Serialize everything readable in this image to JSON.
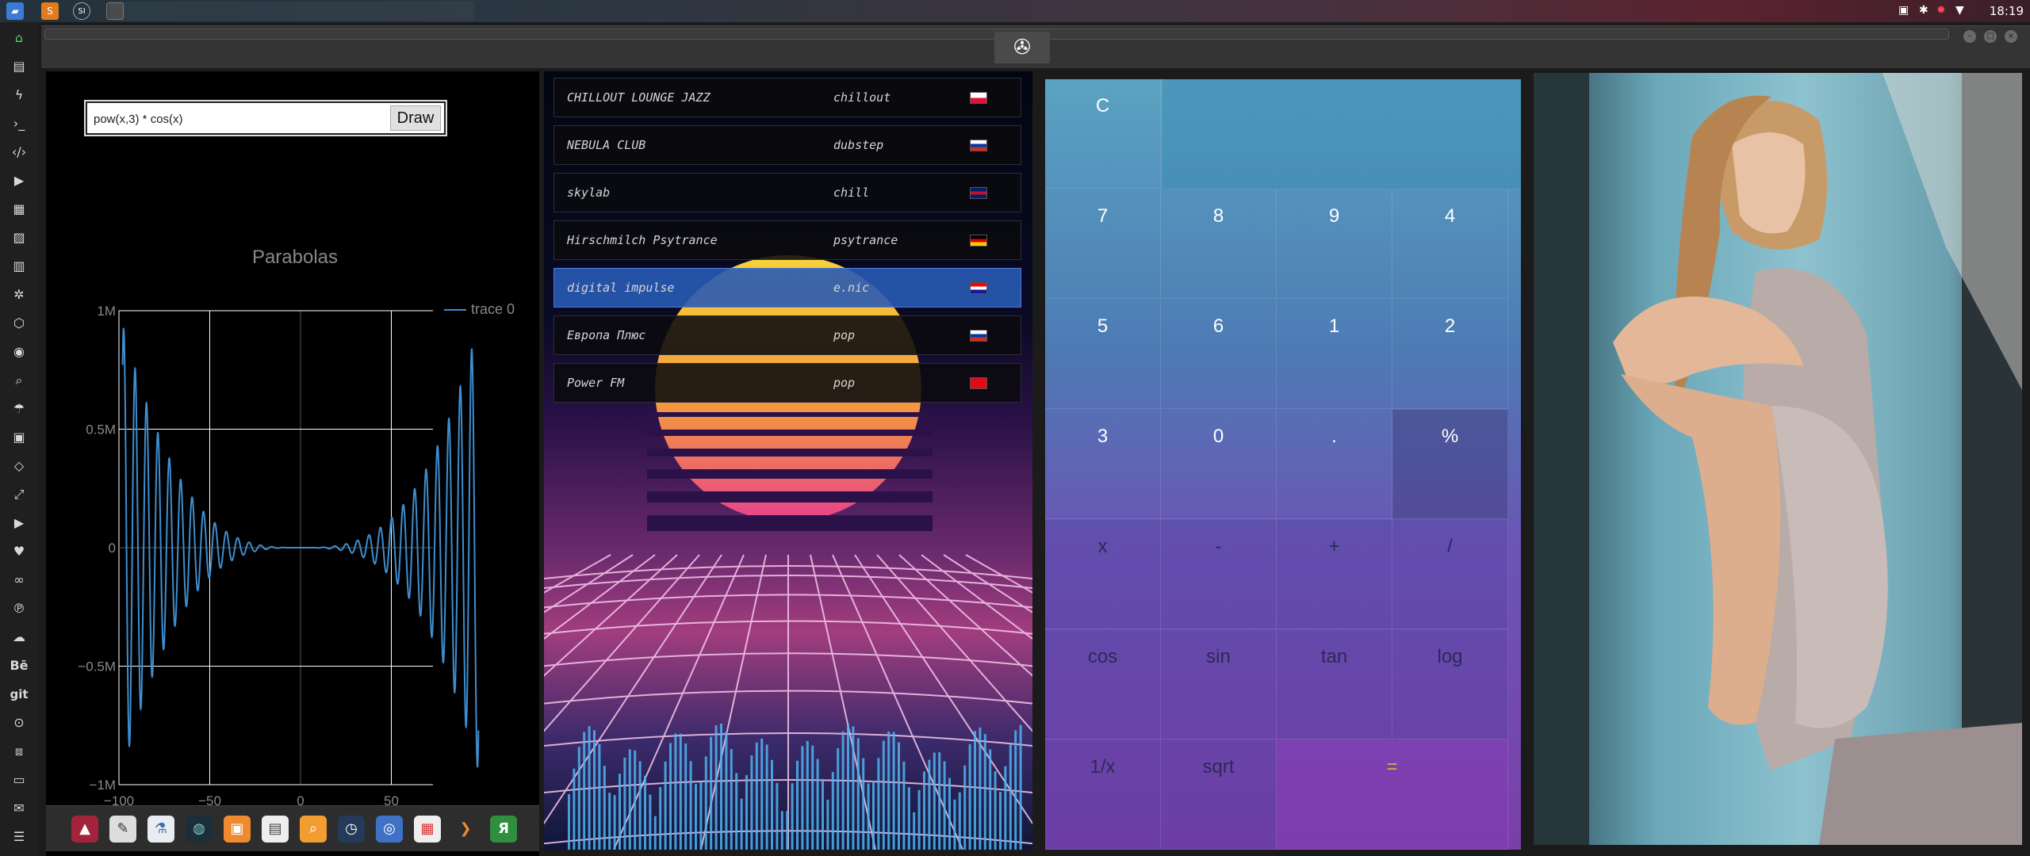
{
  "topbar": {
    "apps": [
      {
        "icon": "files-icon",
        "color": "#4a90e2"
      },
      {
        "icon": "sublime-icon",
        "color": "#f28c28"
      },
      {
        "icon": "rebel-icon",
        "label": "SI"
      },
      {
        "icon": "window-icon"
      }
    ],
    "clock": "18:19"
  },
  "dock": {
    "items": [
      "home-icon",
      "document-icon",
      "bolt-icon",
      "terminal-icon",
      "code-icon",
      "play-icon",
      "files-icon",
      "image-icon",
      "news-icon",
      "settings-icon",
      "network-icon",
      "globe-icon",
      "search-icon",
      "umbrella-icon",
      "contacts-icon",
      "tag-icon",
      "expand-icon",
      "youtube-icon",
      "heart-icon",
      "infinity-icon",
      "pinterest-icon",
      "cloud-icon",
      "behance-icon",
      "git-icon",
      "github-icon",
      "cubes-icon",
      "map-icon",
      "mail-icon",
      "list-icon"
    ],
    "behance_label": "Bē",
    "git_label": "git"
  },
  "plot": {
    "expression": "pow(x,3) * cos(x)",
    "draw_label": "Draw",
    "colors": {
      "trace": "#3e8ed0",
      "grid": "#ffffff",
      "text": "#888888"
    }
  },
  "chart_data": {
    "type": "line",
    "title": "Parabolas",
    "xlabel": "",
    "ylabel": "",
    "xlim": [
      -100,
      100
    ],
    "ylim": [
      -1000000,
      1000000
    ],
    "x_ticks": [
      "−100",
      "−50",
      "0",
      "50"
    ],
    "y_ticks": [
      "1M",
      "0.5M",
      "0",
      "−0.5M",
      "−1M"
    ],
    "legend": "top-right",
    "grid": true,
    "series": [
      {
        "name": "trace 0",
        "function": "pow(x,3) * cos(x)"
      }
    ]
  },
  "radio": {
    "stations": [
      {
        "name": "CHILLOUT LOUNGE JAZZ",
        "genre": "chillout",
        "flag": "flag-poland-icon",
        "active": false
      },
      {
        "name": "NEBULA CLUB",
        "genre": "dubstep",
        "flag": "flag-russia-icon",
        "active": false
      },
      {
        "name": "skylab",
        "genre": "chill",
        "flag": "flag-uk-icon",
        "active": false
      },
      {
        "name": "Hirschmilch Psytrance",
        "genre": "psytrance",
        "flag": "flag-germany-icon",
        "active": false
      },
      {
        "name": "digital impulse",
        "genre": "e.nic",
        "flag": "flag-croatia-icon",
        "active": true
      },
      {
        "name": "Европа Плюс",
        "genre": "pop",
        "flag": "flag-russia-icon",
        "active": false
      },
      {
        "name": "Power FM",
        "genre": "pop",
        "flag": "flag-turkey-icon",
        "active": false
      }
    ]
  },
  "calculator": {
    "clear": "C",
    "display": "",
    "keys": [
      "7",
      "8",
      "9",
      "4",
      "5",
      "6",
      "1",
      "2",
      "3",
      "0",
      ".",
      "%",
      "x",
      "-",
      "+",
      "/",
      "cos",
      "sin",
      "tan",
      "log",
      "1/x",
      "sqrt",
      "="
    ]
  },
  "bottom_dock": {
    "items": [
      "arch-icon",
      "editor-icon",
      "flask-icon",
      "planet-icon",
      "photos-icon",
      "browser-icon",
      "search-app-icon",
      "clock-app-icon",
      "globe-app-icon",
      "calendar-icon",
      "arrow-app-icon",
      "yandex-icon"
    ],
    "yandex_label": "Я"
  }
}
